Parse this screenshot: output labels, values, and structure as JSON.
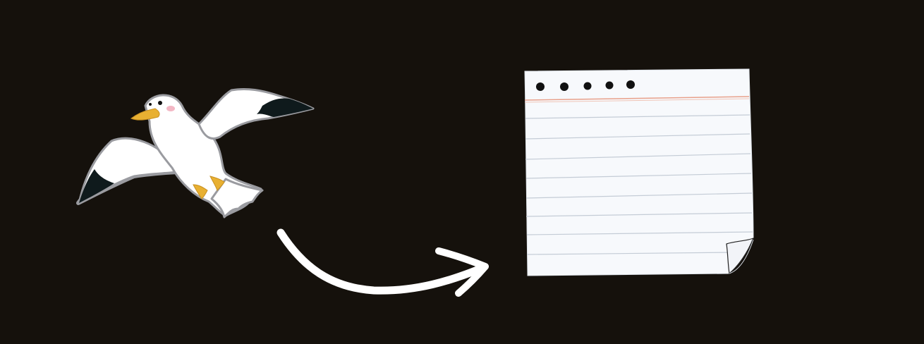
{
  "canvas": {
    "background_color": "#15110c"
  },
  "illustration": {
    "bird": {
      "icon": "seagull-icon",
      "body_color": "#ffffff",
      "outline_color": "#9a9ba0",
      "wingtip_color": "#0f1a1c",
      "beak_color": "#e8b032",
      "feet_color": "#e8b032",
      "cheek_color": "#f3b7c4"
    },
    "arrow": {
      "icon": "curved-arrow-right-icon",
      "color": "#ffffff"
    },
    "notepad": {
      "icon": "lined-notepad-icon",
      "paper_color": "#f7f9fc",
      "rule_color": "#c4ccd6",
      "margin_line_color": "#e8a08a",
      "binding_hole_color": "#111111",
      "binding_hole_count": 5,
      "ruled_line_count": 9,
      "curled_corner": true
    }
  }
}
